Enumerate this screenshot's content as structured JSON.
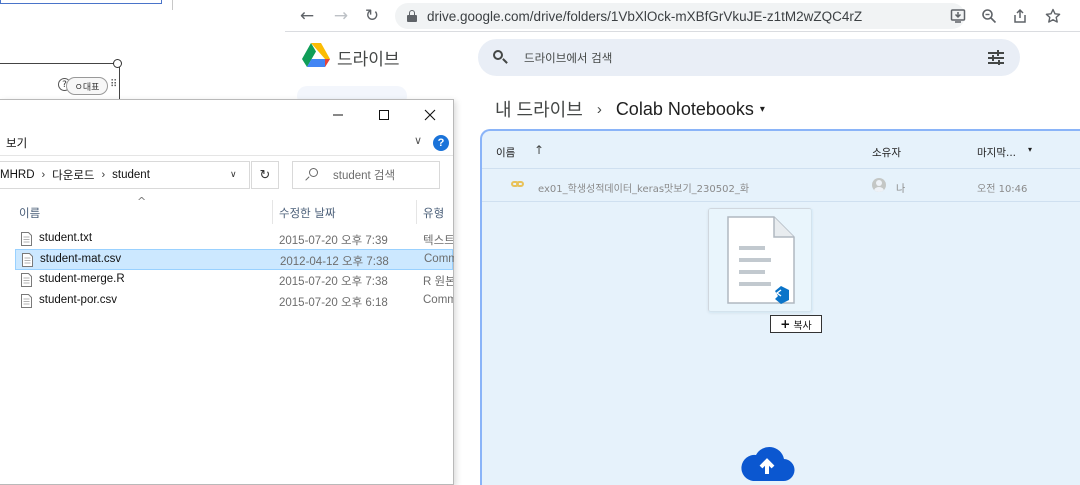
{
  "background_app": {
    "chip_label": "ㅇ대표",
    "help_glyph": "?"
  },
  "browser": {
    "url": "drive.google.com/drive/folders/1VbXlOck-mXBfGrVkuJE-z1tM2wZQC4rZ",
    "nav": {
      "back": "←",
      "forward": "→",
      "reload": "↻"
    },
    "toolbar_icons": [
      "install-icon",
      "zoom-icon",
      "share-icon",
      "bookmark-star-icon"
    ]
  },
  "drive": {
    "app_name": "드라이브",
    "search_placeholder": "드라이브에서 검색",
    "breadcrumb": {
      "root": "내 드라이브",
      "separator": "›",
      "current": "Colab Notebooks",
      "caret": "▾"
    },
    "columns": {
      "name": "이름",
      "sort_arrow": "↑",
      "owner": "소유자",
      "modified": "마지막...",
      "modified_caret": "▾"
    },
    "files": [
      {
        "name": "ex01_학생성적데이터_keras맛보기_230502_화",
        "owner": "나",
        "modified": "오전 10:46"
      }
    ],
    "drag": {
      "copy_label": "복사",
      "copy_plus": "+"
    },
    "colors": {
      "dropzone_bg": "#e6f2fb",
      "dropzone_border": "#8ab4f8",
      "upload_blue": "#0b57d0",
      "vscode_blue": "#0a74c9"
    }
  },
  "explorer": {
    "window_buttons": {
      "minimize": "—",
      "maximize": "☐",
      "close": "✕"
    },
    "ribbon_label": "보기",
    "ribbon_chevron": "∨",
    "help": "?",
    "address": [
      "MHRD",
      "다운로드",
      "student"
    ],
    "address_sep": "›",
    "address_dropdown": "∨",
    "refresh": "↻",
    "search_placeholder": "student 검색",
    "columns": {
      "name": "이름",
      "sort": "^",
      "date": "수정한 날짜",
      "type": "유형"
    },
    "files": [
      {
        "name": "student.txt",
        "date": "2015-07-20 오후 7:39",
        "type": "텍스트",
        "selected": false
      },
      {
        "name": "student-mat.csv",
        "date": "2012-04-12 오후 7:38",
        "type": "Comma",
        "selected": true
      },
      {
        "name": "student-merge.R",
        "date": "2015-07-20 오후 7:38",
        "type": "R 원본",
        "selected": false
      },
      {
        "name": "student-por.csv",
        "date": "2015-07-20 오후 6:18",
        "type": "Comma",
        "selected": false
      }
    ],
    "selection_color": "#cce8ff"
  }
}
